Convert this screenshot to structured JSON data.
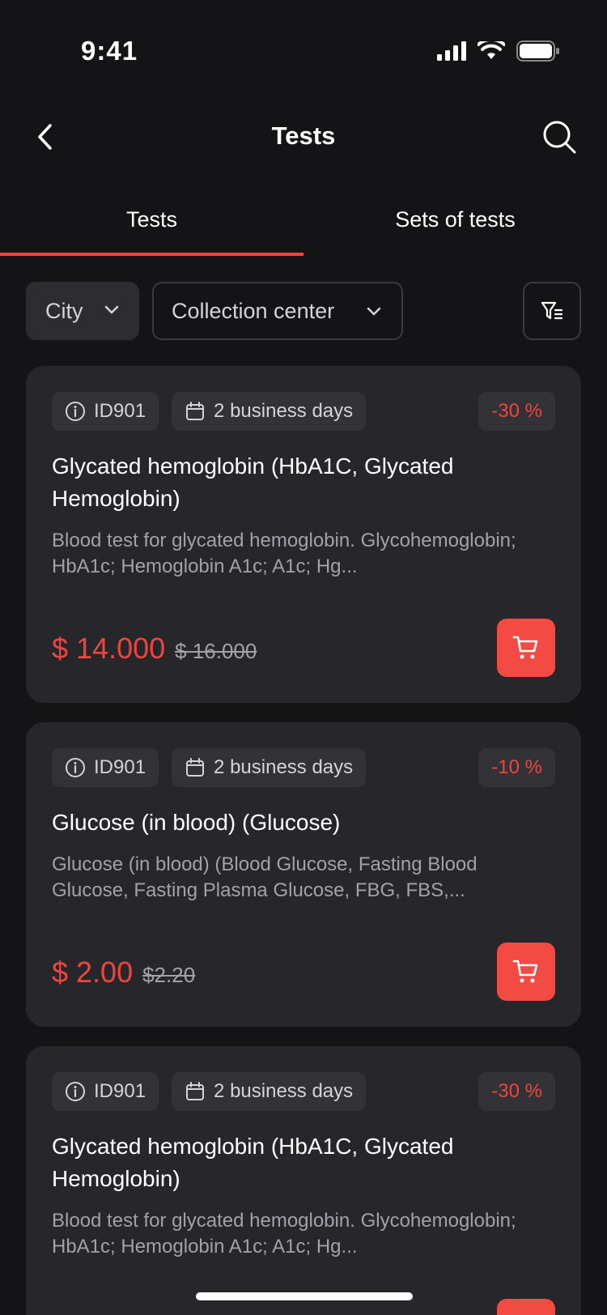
{
  "status_bar": {
    "time": "9:41"
  },
  "nav": {
    "title": "Tests"
  },
  "tabs": [
    {
      "label": "Tests",
      "active": true
    },
    {
      "label": "Sets of tests",
      "active": false
    }
  ],
  "filters": {
    "city": "City",
    "collection_center": "Collection center"
  },
  "cards": [
    {
      "id": "ID901",
      "duration": "2 business days",
      "discount": "-30 %",
      "title": "Glycated hemoglobin (HbA1C, Glycated Hemoglobin)",
      "description": "Blood test for glycated hemoglobin. Glycohemoglobin; HbA1c; Hemoglobin A1c; A1c; Hg...",
      "price": "$ 14.000",
      "old_price": "$ 16.000"
    },
    {
      "id": "ID901",
      "duration": "2 business days",
      "discount": "-10 %",
      "title": "Glucose (in blood) (Glucose)",
      "description": "Glucose (in blood) (Blood Glucose, Fasting Blood Glucose, Fasting Plasma Glucose, FBG, FBS,...",
      "price": "$ 2.00",
      "old_price": "$2.20"
    },
    {
      "id": "ID901",
      "duration": "2 business days",
      "discount": "-30 %",
      "title": "Glycated hemoglobin (HbA1C, Glycated Hemoglobin)",
      "description": "Blood test for glycated hemoglobin. Glycohemoglobin; HbA1c; Hemoglobin A1c; A1c; Hg...",
      "price": "",
      "old_price": ""
    }
  ],
  "colors": {
    "accent": "#f0453f",
    "card_bg": "#27272b",
    "background": "#141416"
  },
  "icons": [
    "back-icon",
    "search-icon",
    "chevron-down-icon",
    "filter-icon",
    "info-icon",
    "calendar-icon",
    "cart-icon"
  ]
}
